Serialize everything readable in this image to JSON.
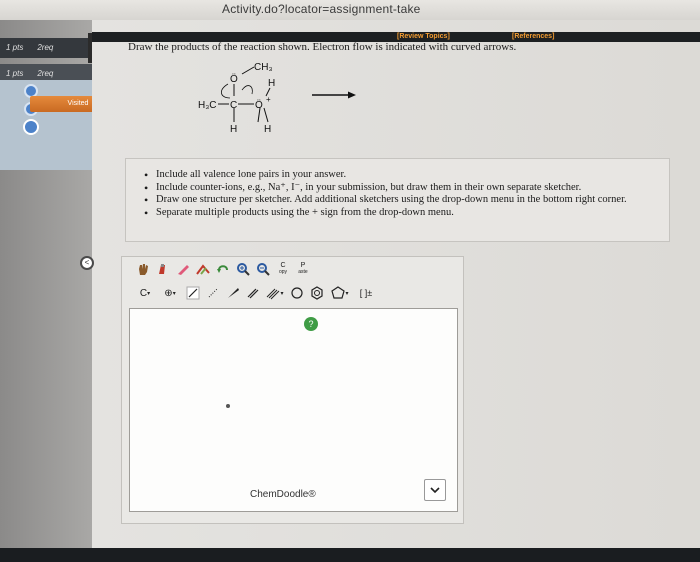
{
  "browser": {
    "url_fragment": "Activity.do?locator=assignment-take"
  },
  "sidebar": {
    "items": [
      {
        "points": "1 pts",
        "requests": "2req"
      },
      {
        "points": "1 pts",
        "requests": "2req"
      }
    ],
    "visited_label": "Visited"
  },
  "header": {
    "review_topics": "[Review Topics]",
    "references": "[References]"
  },
  "question": {
    "prompt": "Draw the products of the reaction shown. Electron flow is indicated with curved arrows.",
    "molecule": {
      "ch3": "CH₃",
      "h_top": "H",
      "h3c": "H₃C",
      "c": "C",
      "o_left": "Ö",
      "o_right": "Ö",
      "o_charge": "+",
      "h_bottom_left": "H",
      "h_bottom_right": "H"
    }
  },
  "instructions": [
    "Include all valence lone pairs in your answer.",
    "Include counter-ions, e.g., Na⁺, I⁻, in your submission, but draw them in their own separate sketcher.",
    "Draw one structure per sketcher. Add additional sketchers using the drop-down menu in the bottom right corner.",
    "Separate multiple products using the + sign from the drop-down menu."
  ],
  "sketcher": {
    "copy_label": "C",
    "copy_sub": "opy",
    "paste_label": "P",
    "paste_sub": "aste",
    "element_label": "C",
    "charge_label": "⊕",
    "bracket_label": "[ ]±",
    "help_label": "?",
    "brand": "ChemDoodle®"
  }
}
